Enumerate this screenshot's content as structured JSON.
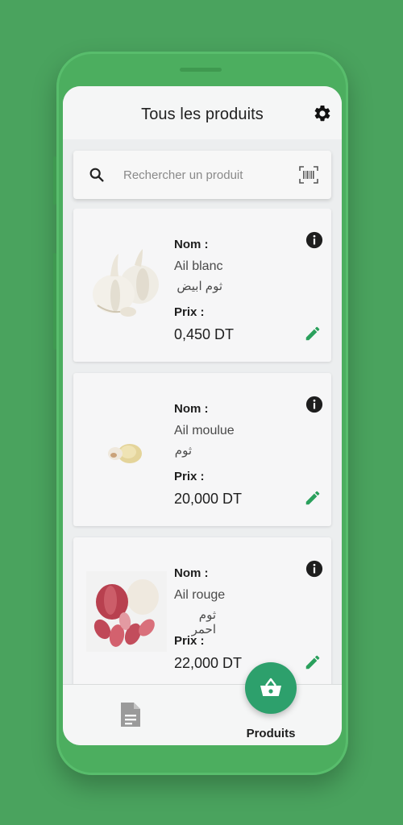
{
  "header": {
    "title": "Tous les produits",
    "settings_icon": "gear-icon"
  },
  "search": {
    "placeholder": "Rechercher un produit",
    "value": "",
    "left_icon": "search-icon",
    "right_icon": "barcode-scan-icon"
  },
  "product_labels": {
    "name_label": "Nom :",
    "price_label": "Prix :"
  },
  "products": [
    {
      "name": "Ail blanc",
      "name_ar": "ثوم ابيض",
      "price": "0,450 DT",
      "image": "white-garlic"
    },
    {
      "name": "Ail moulue",
      "name_ar": "ثوم",
      "price": "20,000 DT",
      "image": "ground-garlic"
    },
    {
      "name": "Ail rouge",
      "name_ar": "ثوم احمر",
      "price": "22,000 DT",
      "image": "red-garlic"
    }
  ],
  "bottom_nav": {
    "items": [
      {
        "icon": "document-icon",
        "label": ""
      },
      {
        "icon": "basket-icon",
        "label": "Produits",
        "active": true
      }
    ]
  },
  "colors": {
    "background": "#4aa35e",
    "accent": "#2da06c",
    "edit": "#2aa05c"
  }
}
